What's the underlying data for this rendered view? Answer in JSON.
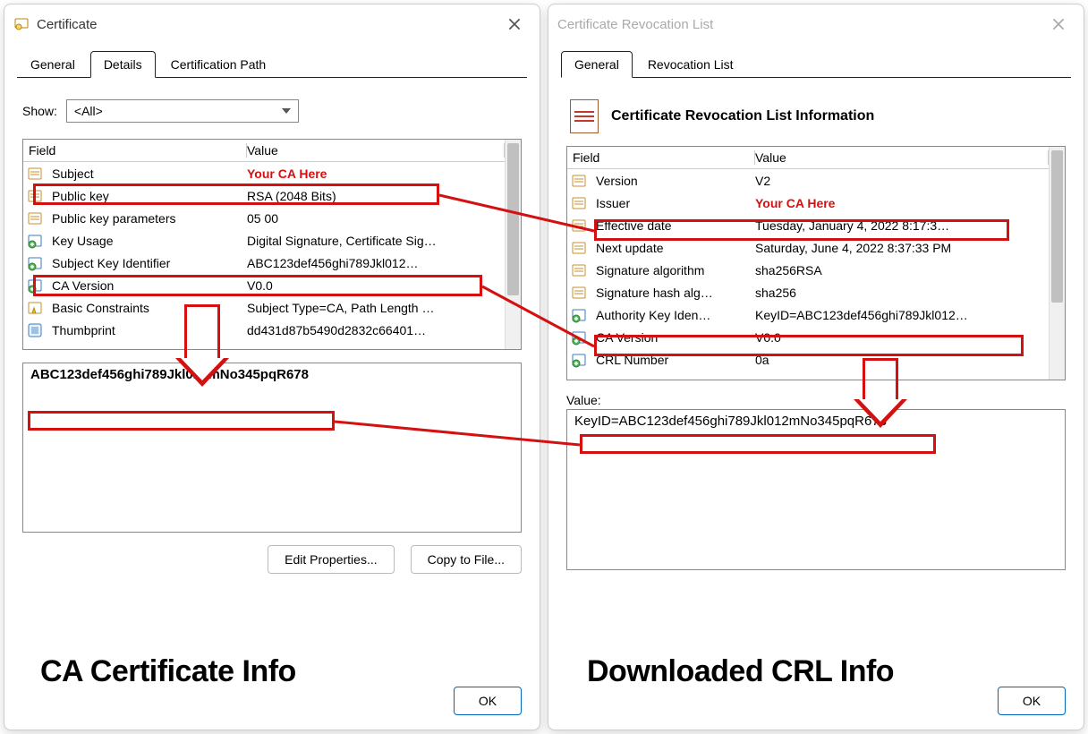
{
  "left": {
    "title": "Certificate",
    "tabs": [
      "General",
      "Details",
      "Certification Path"
    ],
    "activeTab": 1,
    "showLabel": "Show:",
    "showValue": "<All>",
    "gridHeaders": {
      "field": "Field",
      "value": "Value"
    },
    "rows": [
      {
        "icon": "prop",
        "field": "Subject",
        "value": "Your CA Here",
        "hl": true
      },
      {
        "icon": "prop",
        "field": "Public key",
        "value": "RSA (2048 Bits)"
      },
      {
        "icon": "prop",
        "field": "Public key parameters",
        "value": "05 00"
      },
      {
        "icon": "ext",
        "field": "Key Usage",
        "value": "Digital Signature, Certificate Sig…"
      },
      {
        "icon": "ext2",
        "field": "Subject Key Identifier",
        "value": "ABC123def456ghi789Jkl012…"
      },
      {
        "icon": "ext",
        "field": "CA Version",
        "value": "V0.0"
      },
      {
        "icon": "warn",
        "field": "Basic Constraints",
        "value": "Subject Type=CA, Path Length …"
      },
      {
        "icon": "thumb",
        "field": "Thumbprint",
        "value": "dd431d87b5490d2832c66401…"
      }
    ],
    "detailValue": "ABC123def456ghi789Jkl012mNo345pqR678",
    "buttons": {
      "editProps": "Edit Properties...",
      "copyFile": "Copy to File..."
    },
    "ok": "OK",
    "caption": "CA Certificate Info"
  },
  "right": {
    "title": "Certificate Revocation List",
    "tabs": [
      "General",
      "Revocation List"
    ],
    "activeTab": 0,
    "header": "Certificate Revocation List Information",
    "gridHeaders": {
      "field": "Field",
      "value": "Value"
    },
    "rows": [
      {
        "icon": "prop",
        "field": "Version",
        "value": "V2"
      },
      {
        "icon": "prop",
        "field": "Issuer",
        "value": "Your CA Here",
        "hl": true
      },
      {
        "icon": "prop",
        "field": "Effective date",
        "value": "Tuesday, January 4, 2022 8:17:3…"
      },
      {
        "icon": "prop",
        "field": "Next update",
        "value": "Saturday, June 4, 2022 8:37:33 PM"
      },
      {
        "icon": "prop",
        "field": "Signature algorithm",
        "value": "sha256RSA"
      },
      {
        "icon": "prop",
        "field": "Signature hash alg…",
        "value": "sha256"
      },
      {
        "icon": "ext2",
        "field": "Authority Key Iden…",
        "value": "KeyID=ABC123def456ghi789Jkl012…"
      },
      {
        "icon": "ext",
        "field": "CA Version",
        "value": "V0.0"
      },
      {
        "icon": "ext",
        "field": "CRL Number",
        "value": "0a"
      }
    ],
    "valueLabel": "Value:",
    "detailValue": "KeyID=ABC123def456ghi789Jkl012mNo345pqR678",
    "ok": "OK",
    "caption": "Downloaded CRL Info"
  },
  "iconNames": {
    "cert": "certificate-icon",
    "crl": "crl-icon",
    "prop": "property-icon",
    "ext": "extension-icon",
    "ext2": "extension-alt-icon",
    "warn": "constraint-icon",
    "thumb": "thumbprint-icon",
    "close": "close-icon",
    "dropdown": "chevron-down-icon"
  }
}
